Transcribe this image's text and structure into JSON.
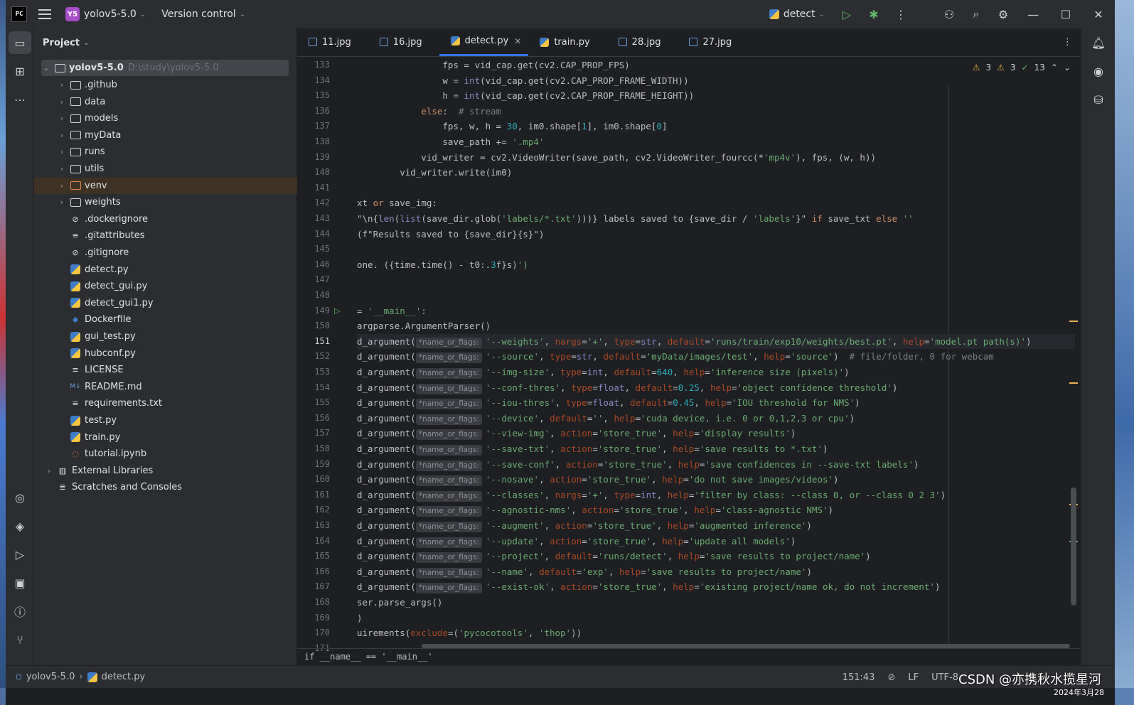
{
  "titlebar": {
    "logo": "PC",
    "project_badge": "Y5",
    "project": "yolov5-5.0",
    "vcs": "Version control",
    "run_config": "detect"
  },
  "sidebar": {
    "title": "Project",
    "root": {
      "name": "yolov5-5.0",
      "path": "D:\\study\\yolov5-5.0"
    },
    "items": [
      {
        "name": ".github",
        "kind": "folder"
      },
      {
        "name": "data",
        "kind": "folder"
      },
      {
        "name": "models",
        "kind": "package"
      },
      {
        "name": "myData",
        "kind": "folder"
      },
      {
        "name": "runs",
        "kind": "folder"
      },
      {
        "name": "utils",
        "kind": "package"
      },
      {
        "name": "venv",
        "kind": "folder-excluded"
      },
      {
        "name": "weights",
        "kind": "folder"
      },
      {
        "name": ".dockerignore",
        "kind": "ignore"
      },
      {
        "name": ".gitattributes",
        "kind": "text"
      },
      {
        "name": ".gitignore",
        "kind": "ignore"
      },
      {
        "name": "detect.py",
        "kind": "python"
      },
      {
        "name": "detect_gui.py",
        "kind": "python"
      },
      {
        "name": "detect_gui1.py",
        "kind": "python"
      },
      {
        "name": "Dockerfile",
        "kind": "docker"
      },
      {
        "name": "gui_test.py",
        "kind": "python"
      },
      {
        "name": "hubconf.py",
        "kind": "python"
      },
      {
        "name": "LICENSE",
        "kind": "text"
      },
      {
        "name": "README.md",
        "kind": "markdown"
      },
      {
        "name": "requirements.txt",
        "kind": "text"
      },
      {
        "name": "test.py",
        "kind": "python"
      },
      {
        "name": "train.py",
        "kind": "python"
      },
      {
        "name": "tutorial.ipynb",
        "kind": "notebook"
      }
    ],
    "external": "External Libraries",
    "scratches": "Scratches and Consoles"
  },
  "tabs": [
    {
      "label": "11.jpg",
      "kind": "image"
    },
    {
      "label": "16.jpg",
      "kind": "image"
    },
    {
      "label": "detect.py",
      "kind": "python",
      "active": true
    },
    {
      "label": "train.py",
      "kind": "python"
    },
    {
      "label": "28.jpg",
      "kind": "image"
    },
    {
      "label": "27.jpg",
      "kind": "image"
    }
  ],
  "inspections": {
    "warnings": "3",
    "weak_warnings": "3",
    "ok": "13"
  },
  "code": {
    "lines": [
      {
        "n": "133",
        "t": "                fps = vid_cap.get(cv2.CAP_PROP_FPS)"
      },
      {
        "n": "134",
        "t": "                w = int(vid_cap.get(cv2.CAP_PROP_FRAME_WIDTH))"
      },
      {
        "n": "135",
        "t": "                h = int(vid_cap.get(cv2.CAP_PROP_FRAME_HEIGHT))"
      },
      {
        "n": "136",
        "t": "            else:  # stream"
      },
      {
        "n": "137",
        "t": "                fps, w, h = 30, im0.shape[1], im0.shape[0]"
      },
      {
        "n": "138",
        "t": "                save_path += '.mp4'"
      },
      {
        "n": "139",
        "t": "            vid_writer = cv2.VideoWriter(save_path, cv2.VideoWriter_fourcc(*'mp4v'), fps, (w, h))"
      },
      {
        "n": "140",
        "t": "        vid_writer.write(im0)"
      },
      {
        "n": "141",
        "t": ""
      },
      {
        "n": "142",
        "t": "xt or save_img:"
      },
      {
        "n": "143",
        "t": "\"\\n{len(list(save_dir.glob('labels/*.txt')))} labels saved to {save_dir / 'labels'}\" if save_txt else ''"
      },
      {
        "n": "144",
        "t": "(f\"Results saved to {save_dir}{s}\")"
      },
      {
        "n": "145",
        "t": ""
      },
      {
        "n": "146",
        "t": "one. ({time.time() - t0:.3f}s)')"
      },
      {
        "n": "147",
        "t": ""
      },
      {
        "n": "148",
        "t": ""
      },
      {
        "n": "149",
        "t": "= '__main__':"
      },
      {
        "n": "150",
        "t": "argparse.ArgumentParser()"
      },
      {
        "n": "151",
        "t": "d_argument(",
        "hint": "*name_or_flags:",
        "rest": "'--weights', nargs='+', type=str, default='runs/train/exp10/weights/best.pt', help='model.pt path(s)')"
      },
      {
        "n": "152",
        "t": "d_argument(",
        "hint": "*name_or_flags:",
        "rest": "'--source', type=str, default='myData/images/test', help='source')  # file/folder, 0 for webcam"
      },
      {
        "n": "153",
        "t": "d_argument(",
        "hint": "*name_or_flags:",
        "rest": "'--img-size', type=int, default=640, help='inference size (pixels)')"
      },
      {
        "n": "154",
        "t": "d_argument(",
        "hint": "*name_or_flags:",
        "rest": "'--conf-thres', type=float, default=0.25, help='object confidence threshold')"
      },
      {
        "n": "155",
        "t": "d_argument(",
        "hint": "*name_or_flags:",
        "rest": "'--iou-thres', type=float, default=0.45, help='IOU threshold for NMS')"
      },
      {
        "n": "156",
        "t": "d_argument(",
        "hint": "*name_or_flags:",
        "rest": "'--device', default='', help='cuda device, i.e. 0 or 0,1,2,3 or cpu')"
      },
      {
        "n": "157",
        "t": "d_argument(",
        "hint": "*name_or_flags:",
        "rest": "'--view-img', action='store_true', help='display results')"
      },
      {
        "n": "158",
        "t": "d_argument(",
        "hint": "*name_or_flags:",
        "rest": "'--save-txt', action='store_true', help='save results to *.txt')"
      },
      {
        "n": "159",
        "t": "d_argument(",
        "hint": "*name_or_flags:",
        "rest": "'--save-conf', action='store_true', help='save confidences in --save-txt labels')"
      },
      {
        "n": "160",
        "t": "d_argument(",
        "hint": "*name_or_flags:",
        "rest": "'--nosave', action='store_true', help='do not save images/videos')"
      },
      {
        "n": "161",
        "t": "d_argument(",
        "hint": "*name_or_flags:",
        "rest": "'--classes', nargs='+', type=int, help='filter by class: --class 0, or --class 0 2 3')"
      },
      {
        "n": "162",
        "t": "d_argument(",
        "hint": "*name_or_flags:",
        "rest": "'--agnostic-nms', action='store_true', help='class-agnostic NMS')"
      },
      {
        "n": "163",
        "t": "d_argument(",
        "hint": "*name_or_flags:",
        "rest": "'--augment', action='store_true', help='augmented inference')"
      },
      {
        "n": "164",
        "t": "d_argument(",
        "hint": "*name_or_flags:",
        "rest": "'--update', action='store_true', help='update all models')"
      },
      {
        "n": "165",
        "t": "d_argument(",
        "hint": "*name_or_flags:",
        "rest": "'--project', default='runs/detect', help='save results to project/name')"
      },
      {
        "n": "166",
        "t": "d_argument(",
        "hint": "*name_or_flags:",
        "rest": "'--name', default='exp', help='save results to project/name')"
      },
      {
        "n": "167",
        "t": "d_argument(",
        "hint": "*name_or_flags:",
        "rest": "'--exist-ok', action='store_true', help='existing project/name ok, do not increment')"
      },
      {
        "n": "168",
        "t": "ser.parse_args()"
      },
      {
        "n": "169",
        "t": ")"
      },
      {
        "n": "170",
        "t": "uirements(exclude=('pycocotools', 'thop'))"
      },
      {
        "n": "171",
        "t": ""
      }
    ],
    "current_line": "151",
    "run_marker_line": "149"
  },
  "editor_breadcrumb": "if __name__ == '__main__'",
  "statusbar": {
    "project": "yolov5-5.0",
    "file": "detect.py",
    "position": "151:43",
    "line_sep": "LF",
    "encoding": "UTF-8"
  },
  "watermark": "CSDN @亦携秋水揽星河",
  "datestamp": "2024年3月28"
}
